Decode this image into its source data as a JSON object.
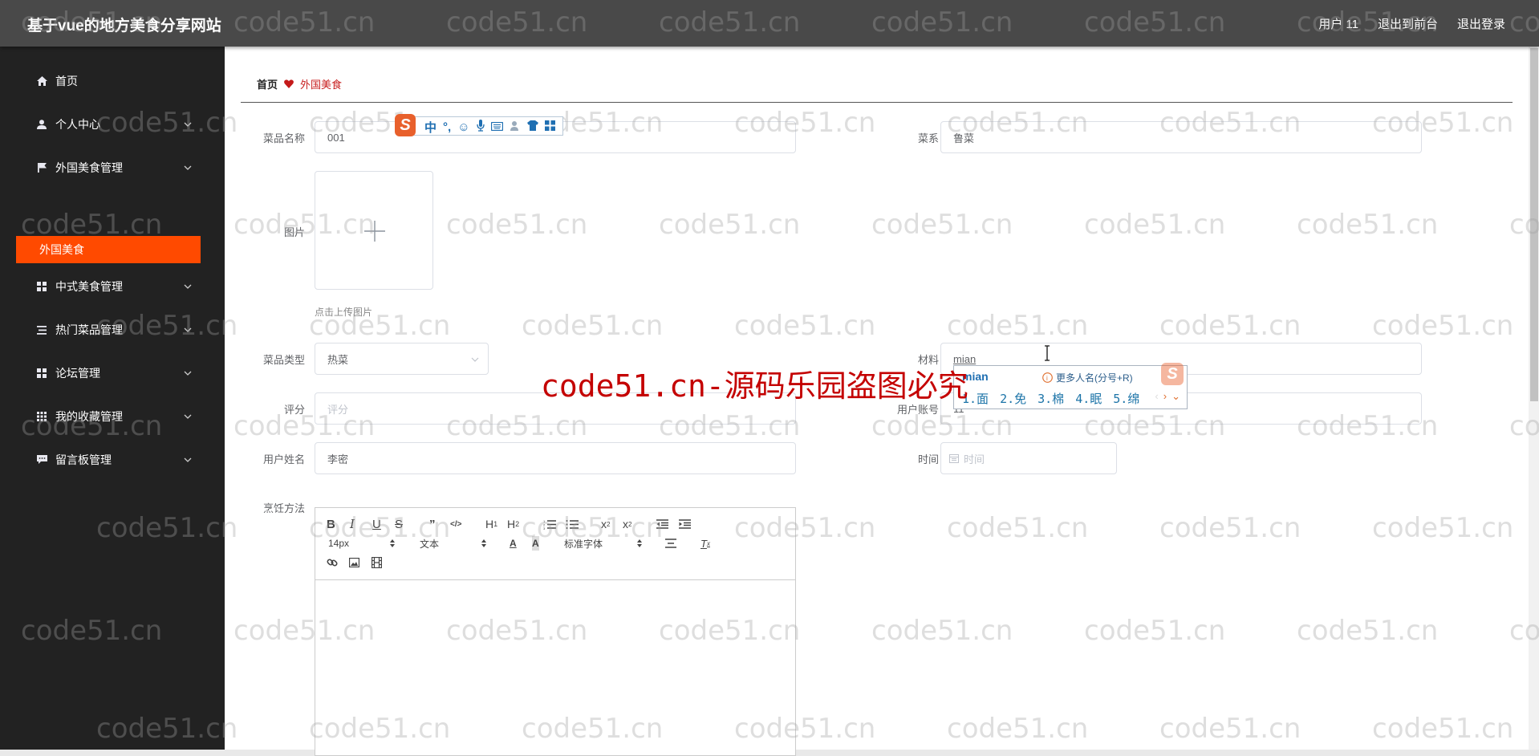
{
  "header": {
    "title": "基于vue的地方美食分享网站",
    "user_label": "用户 11",
    "goto_front": "退出到前台",
    "logout": "退出登录"
  },
  "sidebar": {
    "items": [
      {
        "label": "首页",
        "icon": "home-icon",
        "has_arrow": false
      },
      {
        "label": "个人中心",
        "icon": "user-icon",
        "has_arrow": true
      },
      {
        "label": "外国美食管理",
        "icon": "flag-icon",
        "has_arrow": true
      },
      {
        "label": "中式美食管理",
        "icon": "grid-icon",
        "has_arrow": true
      },
      {
        "label": "热门菜品管理",
        "icon": "list-icon",
        "has_arrow": true
      },
      {
        "label": "论坛管理",
        "icon": "grid-icon",
        "has_arrow": true
      },
      {
        "label": "我的收藏管理",
        "icon": "grid-9-icon",
        "has_arrow": true
      },
      {
        "label": "留言板管理",
        "icon": "comment-icon",
        "has_arrow": true
      }
    ],
    "active_sub": "外国美食",
    "active_color": "#ff4a00"
  },
  "breadcrumb": {
    "home": "首页",
    "current": "外国美食"
  },
  "form": {
    "dish_name": {
      "label": "菜品名称",
      "value": "001"
    },
    "cuisine": {
      "label": "菜系",
      "value": "鲁菜"
    },
    "image": {
      "label": "图片",
      "tip": "点击上传图片"
    },
    "dish_type": {
      "label": "菜品类型",
      "value": "热菜"
    },
    "ingredients": {
      "label": "材料",
      "value": "mian"
    },
    "rating": {
      "label": "评分",
      "placeholder": "评分"
    },
    "user_account": {
      "label": "用户账号",
      "value": "11"
    },
    "user_name": {
      "label": "用户姓名",
      "value": "李密"
    },
    "time": {
      "label": "时间",
      "placeholder": "时间"
    },
    "cooking_method": {
      "label": "烹饪方法"
    }
  },
  "editor": {
    "font_size": "14px",
    "header_type": "文本",
    "font_family": "标准字体",
    "buttons": [
      "bold",
      "italic",
      "underline",
      "strike",
      "blockquote",
      "code-block",
      "h1",
      "h2",
      "ordered-list",
      "bullet-list",
      "subscript",
      "superscript",
      "indent-decrease",
      "indent-increase",
      "color",
      "background",
      "align",
      "clean",
      "link",
      "image",
      "video"
    ]
  },
  "ime": {
    "toolbar_items": [
      "中",
      "°,",
      "☺",
      "mic",
      "keyboard",
      "person",
      "shirt",
      "apps"
    ],
    "pinyin": "mian",
    "more_hint": "更多人名(分号+R)",
    "candidates": [
      "1.面",
      "2.免",
      "3.棉",
      "4.眠",
      "5.绵"
    ]
  },
  "watermark": {
    "text": "code51.cn",
    "banner": "code51.cn-源码乐园盗图必究"
  }
}
